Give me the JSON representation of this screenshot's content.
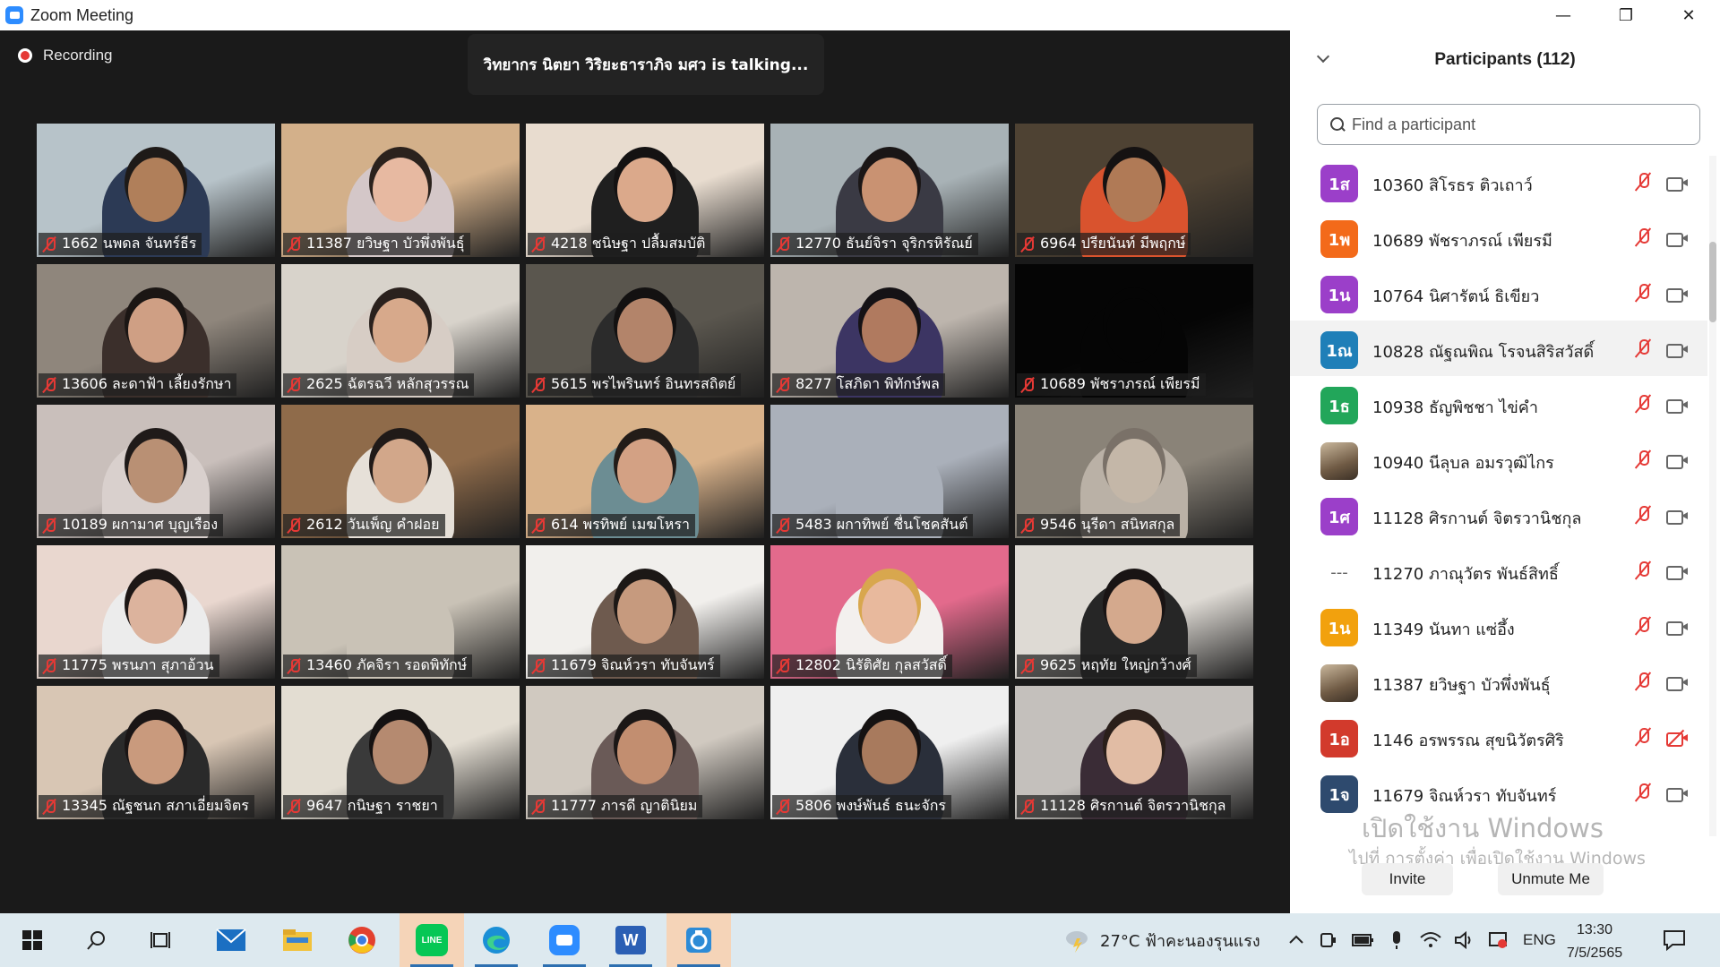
{
  "window": {
    "title": "Zoom Meeting",
    "minimize": "—",
    "restore": "❐",
    "close": "✕"
  },
  "meeting": {
    "recording_label": "Recording",
    "talking_text": "วิทยากร นิตยา วิริยะธาราภิจ มศว is  talking..."
  },
  "tiles": [
    {
      "name": "1662 นพดล  จันทร์ธีร",
      "bg": "#b7c3c9",
      "skin": "#b07f5a",
      "hair": "#1e1a18",
      "shirt": "#2c3a55"
    },
    {
      "name": "11387 ยวิษฐา บัวพึ่งพันธุ์",
      "bg": "#d3b08a",
      "skin": "#e7b9a1",
      "hair": "#2b221d",
      "shirt": "#d4c7c8"
    },
    {
      "name": "4218 ชนิษฐา ปลื้มสมบัติ",
      "bg": "#e8dccf",
      "skin": "#dba98b",
      "hair": "#141212",
      "shirt": "#1f1f1f"
    },
    {
      "name": "12770 ธันย์จิรา จุริกรหิรัณย์",
      "bg": "#a8b2b6",
      "skin": "#c99272",
      "hair": "#1a1616",
      "shirt": "#3a3a44"
    },
    {
      "name": "6964 ปรียนันท์ มีพฤกษ์",
      "bg": "#4e4233",
      "skin": "#b07a56",
      "hair": "#151212",
      "shirt": "#d9532e"
    },
    {
      "name": "13606 ละดาฟ้า เลี้ยงรักษา",
      "bg": "#8f867c",
      "skin": "#cf9f84",
      "hair": "#1b1614",
      "shirt": "#3b2f2b"
    },
    {
      "name": "2625 ฉัตรฉวี  หลักสุวรรณ",
      "bg": "#d8d3cb",
      "skin": "#d7a98b",
      "hair": "#2a211d",
      "shirt": "#d7cdc5"
    },
    {
      "name": "5615 พรไพรินทร์ อินทรสถิตย์",
      "bg": "#5a564e",
      "skin": "#b3846a",
      "hair": "#131111",
      "shirt": "#2b2b2b"
    },
    {
      "name": "8277 โสภิดา พิทักษ์พล",
      "bg": "#bdb5ad",
      "skin": "#b07a5f",
      "hair": "#151215",
      "shirt": "#3c3563"
    },
    {
      "name": "10689 พัชราภรณ์ เพียรมี",
      "bg": "#050505",
      "skin": "#050505",
      "hair": "#050505",
      "shirt": "#050505"
    },
    {
      "name": "10189 ผกามาศ บุญเรือง",
      "bg": "#c9bfbb",
      "skin": "#b99074",
      "hair": "#1f1a19",
      "shirt": "#d9d0cd"
    },
    {
      "name": "2612 วันเพ็ญ คำฝอย",
      "bg": "#8f6b4a",
      "skin": "#d2a78a",
      "hair": "#201a18",
      "shirt": "#e6e0d8"
    },
    {
      "name": "614 พรทิพย์ เมฆโหรา",
      "bg": "#d9b28a",
      "skin": "#d3a184",
      "hair": "#231c18",
      "shirt": "#6c8d93"
    },
    {
      "name": "5483 ผกาทิพย์ ชื่นโชคสันต์",
      "bg": "#aab0ba",
      "skin": "#aab0ba",
      "hair": "#aab0ba",
      "shirt": "#aab0ba"
    },
    {
      "name": "9546 นุรีดา สนิทสกุล",
      "bg": "#8a8378",
      "skin": "#c4b7a8",
      "hair": "#7a7168",
      "shirt": "#bab1a6"
    },
    {
      "name": "11775 พรนภา สุภาอ้วน",
      "bg": "#e9d7cf",
      "skin": "#dcb39d",
      "hair": "#1d1716",
      "shirt": "#ececec"
    },
    {
      "name": "13460 ภัคจิรา รอดพิทักษ์",
      "bg": "#c9c2b6",
      "skin": "#c9c2b6",
      "hair": "#c9c2b6",
      "shirt": "#c9c2b6"
    },
    {
      "name": "11679 จิณห์วรา  ทับจันทร์",
      "bg": "#f1efec",
      "skin": "#c69a7e",
      "hair": "#1c1816",
      "shirt": "#6e5a4e"
    },
    {
      "name": "12802 นิรัติศัย กุลสวัสดิ์",
      "bg": "#e36a8c",
      "skin": "#e8b99d",
      "hair": "#d8a74e",
      "shirt": "#f3f0ee"
    },
    {
      "name": "9625  หฤทัย  ใหญ่กว้างศ์",
      "bg": "#dedad4",
      "skin": "#d4a98d",
      "hair": "#191414",
      "shirt": "#262626"
    },
    {
      "name": "13345 ณัฐชนก สภาเอี่ยมจิตร",
      "bg": "#d8c6b4",
      "skin": "#c99a7d",
      "hair": "#1a1515",
      "shirt": "#2a2a2a"
    },
    {
      "name": "9647 กนิษฐา ราชยา",
      "bg": "#e3ddd2",
      "skin": "#b58a70",
      "hair": "#151212",
      "shirt": "#3a3a3a"
    },
    {
      "name": "11777 ภารดี ญาตินิยม",
      "bg": "#d0c9c0",
      "skin": "#c28e70",
      "hair": "#1b1716",
      "shirt": "#6a5a57"
    },
    {
      "name": "5806 พงษ์พันธ์ ธนะจักร",
      "bg": "#efefef",
      "skin": "#a87a5d",
      "hair": "#151212",
      "shirt": "#2a2f3a"
    },
    {
      "name": "11128 ศิรกานต์ จิตรวานิชกุล",
      "bg": "#c4c0bc",
      "skin": "#e1bca4",
      "hair": "#2a1f1a",
      "shirt": "#3a2c36"
    }
  ],
  "participants_panel": {
    "title": "Participants (112)",
    "search_placeholder": "Find a participant",
    "items": [
      {
        "avatar": "1ส",
        "color": "#9b3fc9",
        "name": "10360 สิโรธร ติวเถาว์",
        "cam_off": false
      },
      {
        "avatar": "1พ",
        "color": "#f36a1a",
        "name": "10689 พัชราภรณ์ เพียรมี",
        "cam_off": false
      },
      {
        "avatar": "1น",
        "color": "#9b3fc9",
        "name": "10764 นิศารัตน์ ธิเขียว",
        "cam_off": false
      },
      {
        "avatar": "1ณ",
        "color": "#1f7fb8",
        "name": "10828 ณัฐณพิณ โรจนสิริสวัสดิ์",
        "cam_off": false
      },
      {
        "avatar": "1ธ",
        "color": "#22a65a",
        "name": "10938 ธัญพิชชา ไข่คำ",
        "cam_off": false
      },
      {
        "avatar": "",
        "color": "photo",
        "name": "10940 นีลุบล อมรวุฒิไกร",
        "cam_off": false
      },
      {
        "avatar": "1ศ",
        "color": "#9b3fc9",
        "name": "11128 ศิรกานต์ จิตรวานิชกุล",
        "cam_off": false
      },
      {
        "avatar": "---",
        "color": "dash",
        "name": "11270 ภาณุวัตร พันธ์สิทธิ์",
        "cam_off": false
      },
      {
        "avatar": "1น",
        "color": "#f2a10d",
        "name": "11349 นันทา แซ่อึ้ง",
        "cam_off": false
      },
      {
        "avatar": "",
        "color": "photo",
        "name": "11387 ยวิษฐา บัวพึ่งพันธุ์",
        "cam_off": false
      },
      {
        "avatar": "1อ",
        "color": "#d23a2c",
        "name": "1146 อรพรรณ สุขนิวัตรศิริ",
        "cam_off": true
      },
      {
        "avatar": "1จ",
        "color": "#2e4a6e",
        "name": "11679 จิณห์วรา  ทับจันทร์",
        "cam_off": false
      }
    ],
    "invite_label": "Invite",
    "unmute_me_label": "Unmute Me",
    "windows_watermark": "เปิดใช้งาน Windows",
    "windows_watermark_sub": "ไปที่ การตั้งค่า เพื่อเปิดใช้งาน Windows"
  },
  "taskbar": {
    "weather": "27°C  ฟ้าคะนองรุนแรง",
    "language": "ENG",
    "time": "13:30",
    "date": "7/5/2565",
    "app_line": "LINE"
  }
}
